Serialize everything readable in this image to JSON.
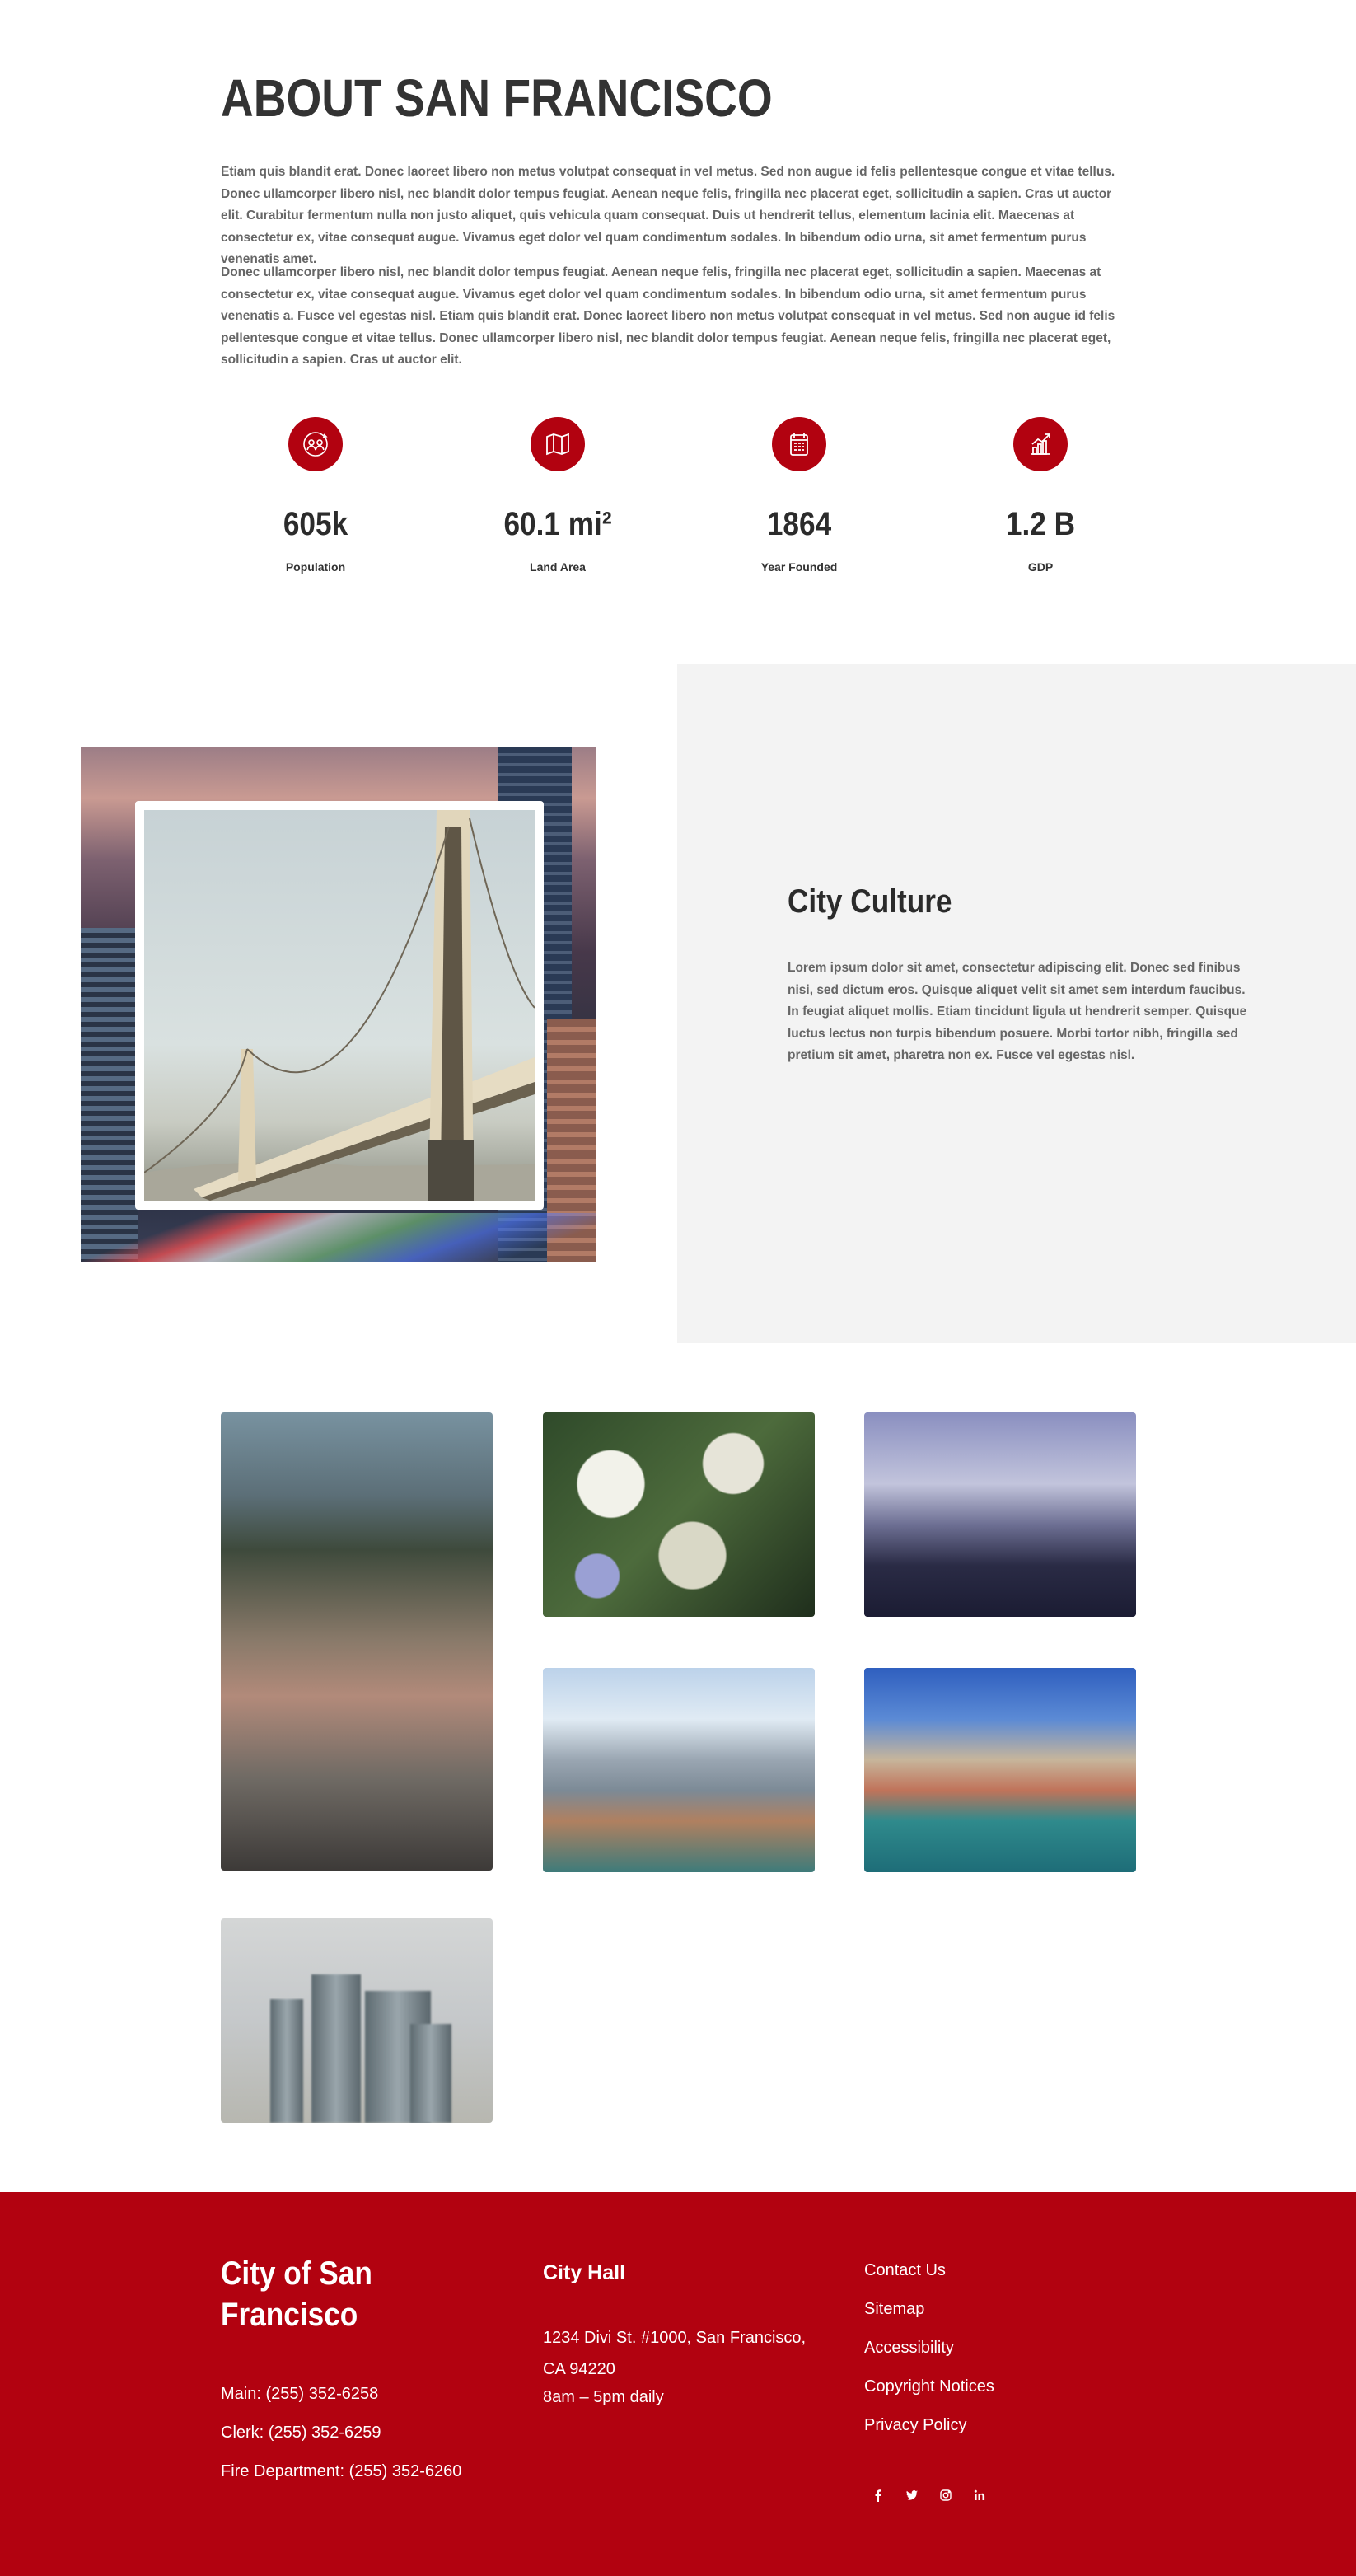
{
  "about": {
    "title": "ABOUT SAN FRANCISCO",
    "paragraph1": "Etiam quis blandit erat. Donec laoreet libero non metus volutpat consequat in vel metus. Sed non augue id felis pellentesque congue et vitae tellus. Donec ullamcorper libero nisl, nec blandit dolor tempus feugiat. Aenean neque felis, fringilla nec placerat eget, sollicitudin a sapien. Cras ut auctor elit. Curabitur fermentum nulla non justo aliquet, quis vehicula quam consequat. Duis ut hendrerit tellus, elementum lacinia elit. Maecenas at consectetur ex, vitae consequat augue. Vivamus eget dolor vel quam condimentum sodales. In bibendum odio urna, sit amet fermentum purus venenatis amet.",
    "paragraph2": "Donec ullamcorper libero nisl, nec blandit dolor tempus feugiat. Aenean neque felis, fringilla nec placerat eget, sollicitudin a sapien. Maecenas at consectetur ex, vitae consequat augue. Vivamus eget dolor vel quam condimentum sodales. In bibendum odio urna, sit amet fermentum purus venenatis a. Fusce vel egestas nisl. Etiam quis blandit erat. Donec laoreet libero non metus volutpat consequat in vel metus. Sed non augue id felis pellentesque congue et vitae tellus. Donec ullamcorper libero nisl, nec blandit dolor tempus feugiat. Aenean neque felis, fringilla nec placerat eget, sollicitudin a sapien. Cras ut auctor elit.",
    "stats": [
      {
        "icon": "population-icon",
        "value": "605k",
        "label": "Population"
      },
      {
        "icon": "map-icon",
        "value": "60.1 mi²",
        "label": "Land Area"
      },
      {
        "icon": "calendar-icon",
        "value": "1864",
        "label": "Year Founded"
      },
      {
        "icon": "growth-chart-icon",
        "value": "1.2 B",
        "label": "GDP"
      }
    ],
    "accent_color": "#b20210"
  },
  "culture": {
    "heading": "City Culture",
    "text": "Lorem ipsum dolor sit amet, consectetur adipiscing elit. Donec sed finibus nisi, sed dictum eros. Quisque aliquet velit sit amet sem interdum faucibus. In feugiat aliquet mollis. Etiam tincidunt ligula ut hendrerit semper. Quisque luctus lectus non turpis bibendum posuere. Morbi tortor nibh, fringilla sed pretium sit amet, pharetra non ex. Fusce vel egestas nisl."
  },
  "footer": {
    "title": "City of San Francisco",
    "phones": {
      "main": "Main: (255) 352-6258",
      "clerk": "Clerk: (255) 352-6259",
      "fire": "Fire Department: (255) 352-6260"
    },
    "city_hall": {
      "heading": "City Hall",
      "address": "1234 Divi St. #1000, San Francisco, CA 94220",
      "hours": "8am – 5pm daily"
    },
    "links": [
      "Contact Us",
      "Sitemap",
      "Accessibility",
      "Copyright Notices",
      "Privacy Policy"
    ],
    "social": [
      "facebook-icon",
      "twitter-icon",
      "instagram-icon",
      "linkedin-icon"
    ],
    "background_color": "#b20210"
  }
}
